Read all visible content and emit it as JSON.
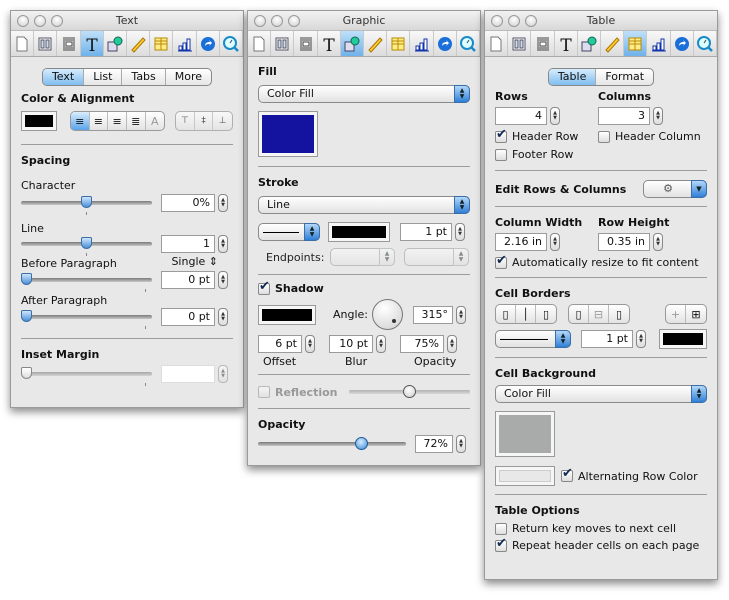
{
  "toolbar_icons": [
    "document-icon",
    "layout-icon",
    "wrap-icon",
    "text-icon",
    "graphic-icon",
    "metrics-icon",
    "table-icon",
    "chart-icon",
    "link-icon",
    "quicktime-icon"
  ],
  "text_window": {
    "title": "Text",
    "tabs": [
      "Text",
      "List",
      "Tabs",
      "More"
    ],
    "active_tab": "Text",
    "color_alignment_header": "Color & Alignment",
    "text_color": "#000000",
    "spacing_header": "Spacing",
    "character_label": "Character",
    "character_value": "0%",
    "character_slider": 0.5,
    "line_label": "Line",
    "line_value": "1",
    "line_slider": 0.5,
    "line_mode": "Single",
    "before_paragraph_label": "Before Paragraph",
    "before_paragraph_value": "0 pt",
    "after_paragraph_label": "After Paragraph",
    "after_paragraph_value": "0 pt",
    "inset_margin_header": "Inset Margin",
    "inset_margin_value": ""
  },
  "graphic_window": {
    "title": "Graphic",
    "fill_header": "Fill",
    "fill_type": "Color Fill",
    "fill_color": "#13139f",
    "stroke_header": "Stroke",
    "stroke_type": "Line",
    "stroke_color": "#000000",
    "stroke_width": "1 pt",
    "endpoints_label": "Endpoints:",
    "shadow_label": "Shadow",
    "shadow_checked": true,
    "shadow_color": "#000000",
    "angle_label": "Angle:",
    "angle_value": "315°",
    "offset_value": "6 pt",
    "offset_label": "Offset",
    "blur_value": "10 pt",
    "blur_label": "Blur",
    "shadow_opacity_value": "75%",
    "shadow_opacity_label": "Opacity",
    "reflection_label": "Reflection",
    "reflection_checked": false,
    "reflection_slider": 0.5,
    "opacity_header": "Opacity",
    "opacity_value": "72%",
    "opacity_slider": 0.72
  },
  "table_window": {
    "title": "Table",
    "tabs": [
      "Table",
      "Format"
    ],
    "active_tab": "Table",
    "rows_label": "Rows",
    "rows_value": "4",
    "columns_label": "Columns",
    "columns_value": "3",
    "header_row_label": "Header Row",
    "header_row_checked": true,
    "header_column_label": "Header Column",
    "header_column_checked": false,
    "footer_row_label": "Footer Row",
    "footer_row_checked": false,
    "edit_rows_columns_label": "Edit Rows & Columns",
    "column_width_label": "Column Width",
    "column_width_value": "2.16 in",
    "row_height_label": "Row Height",
    "row_height_value": "0.35 in",
    "auto_resize_label": "Automatically resize to fit content",
    "auto_resize_checked": true,
    "cell_borders_header": "Cell Borders",
    "border_width": "1 pt",
    "border_color": "#000000",
    "cell_background_header": "Cell Background",
    "cell_background_type": "Color Fill",
    "cell_background_color": "#a9abaa",
    "alternating_row_label": "Alternating Row Color",
    "alternating_row_checked": true,
    "alternating_row_color": "#e8e8e8",
    "table_options_header": "Table Options",
    "return_key_label": "Return key moves to next cell",
    "return_key_checked": false,
    "repeat_header_label": "Repeat header cells on each page",
    "repeat_header_checked": true
  }
}
